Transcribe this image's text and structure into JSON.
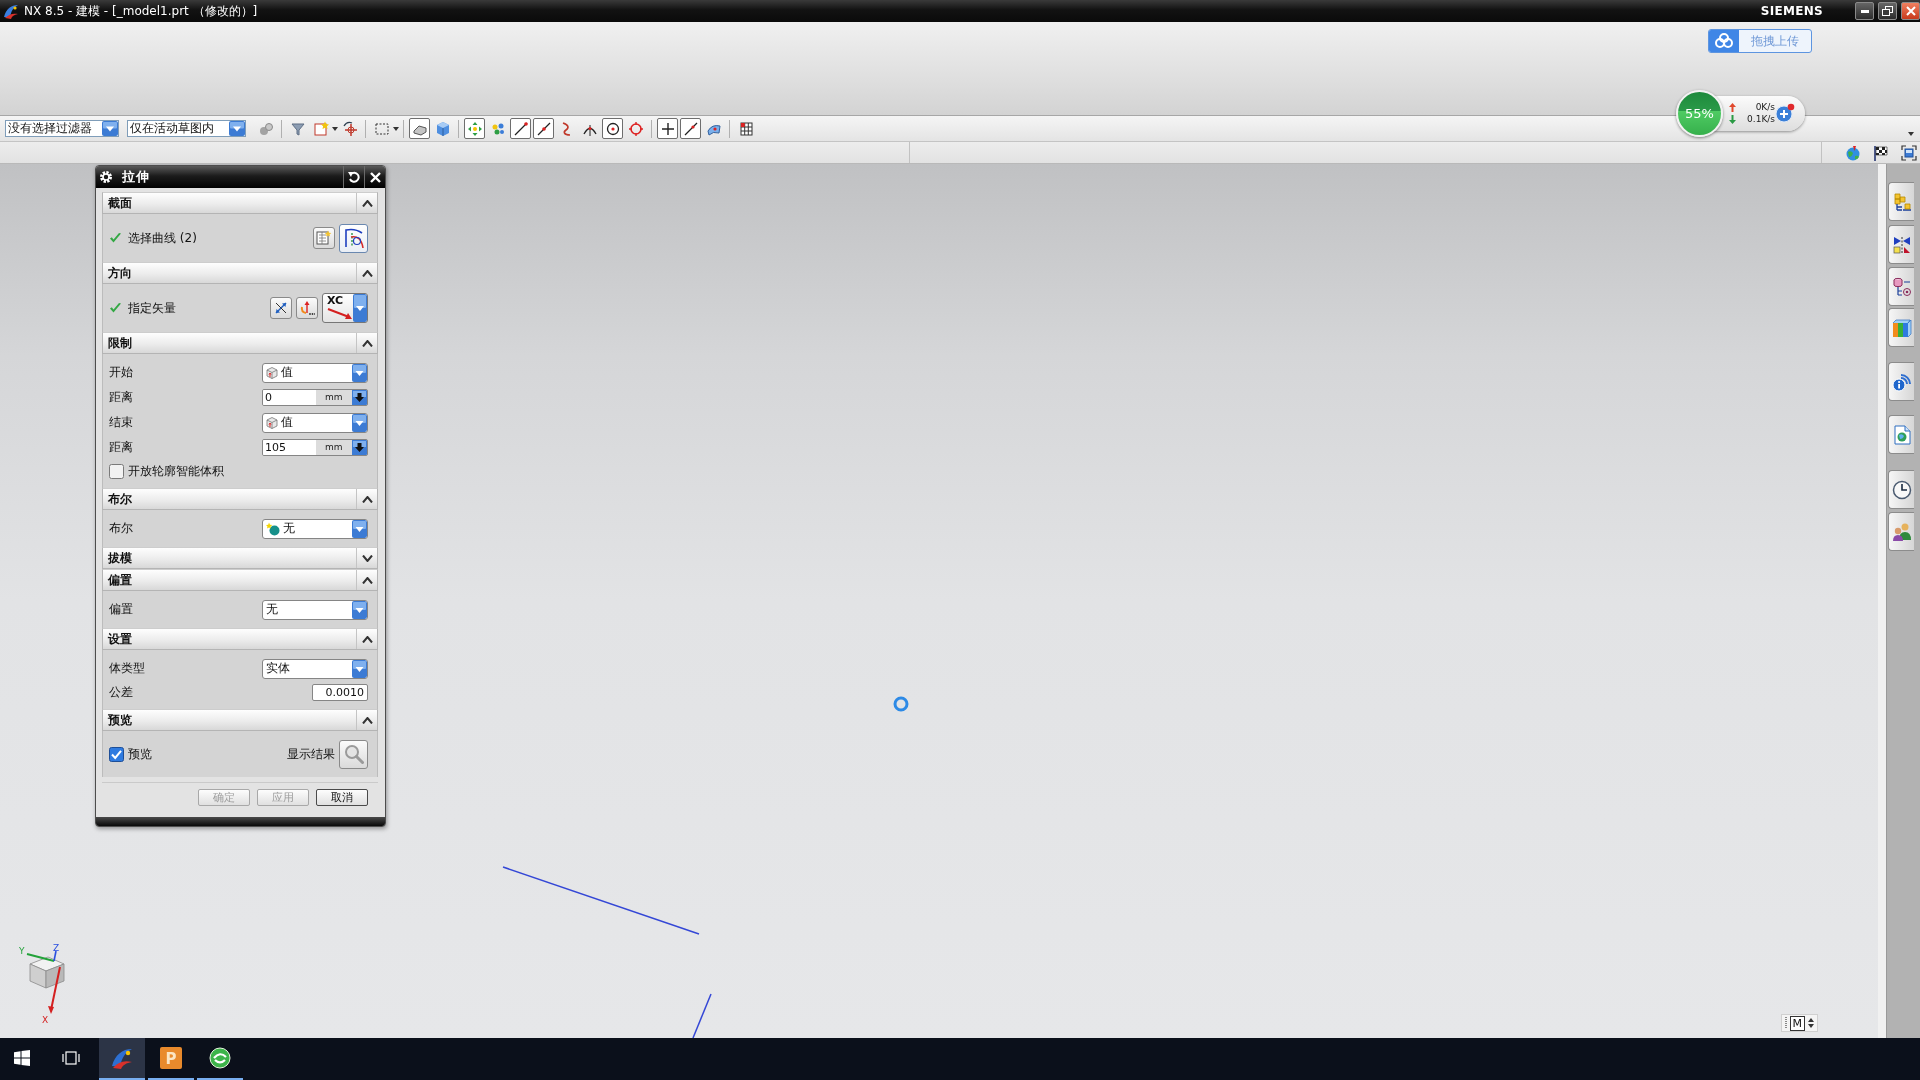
{
  "window": {
    "title": "NX 8.5 - 建模 - [_model1.prt （修改的）]",
    "brand": "SIEMENS"
  },
  "upload_button": {
    "label": "拖拽上传"
  },
  "speed_meter": {
    "percent": "55%",
    "upload": "0K/s",
    "download": "0.1K/s"
  },
  "selection_bar": {
    "filter": "没有选择过滤器",
    "scope": "仅在活动草图内"
  },
  "dialog": {
    "title": "拉伸",
    "sections": [
      {
        "title": "截面",
        "expanded": true,
        "rows": [
          {
            "kind": "selection",
            "label": "选择曲线 (2)",
            "done": true
          }
        ]
      },
      {
        "title": "方向",
        "expanded": true,
        "rows": [
          {
            "kind": "vector",
            "label": "指定矢量",
            "done": true,
            "value": "XC"
          }
        ]
      },
      {
        "title": "限制",
        "expanded": true,
        "rows": [
          {
            "kind": "value_select",
            "label": "开始",
            "value": "值"
          },
          {
            "kind": "number",
            "label": "距离",
            "value": "0",
            "unit": "mm"
          },
          {
            "kind": "value_select",
            "label": "结束",
            "value": "值"
          },
          {
            "kind": "number",
            "label": "距离",
            "value": "105",
            "unit": "mm"
          },
          {
            "kind": "checkbox",
            "label": "开放轮廓智能体积",
            "checked": false
          }
        ]
      },
      {
        "title": "布尔",
        "expanded": true,
        "rows": [
          {
            "kind": "boolean_select",
            "label": "布尔",
            "value": "无"
          }
        ]
      },
      {
        "title": "拔模",
        "expanded": false
      },
      {
        "title": "偏置",
        "expanded": true,
        "rows": [
          {
            "kind": "select",
            "label": "偏置",
            "value": "无"
          }
        ]
      },
      {
        "title": "设置",
        "expanded": true,
        "rows": [
          {
            "kind": "select",
            "label": "体类型",
            "value": "实体"
          },
          {
            "kind": "text_field",
            "label": "公差",
            "value": "0.0010"
          }
        ]
      },
      {
        "title": "预览",
        "expanded": true,
        "rows": [
          {
            "kind": "preview",
            "label": "预览",
            "checked": true,
            "action_label": "显示结果"
          }
        ]
      }
    ],
    "buttons": [
      {
        "label": "确定",
        "disabled": true
      },
      {
        "label": "应用",
        "disabled": true
      },
      {
        "label": "取消",
        "disabled": false
      }
    ]
  },
  "triad": {
    "x_label": "X",
    "y_label": "Y",
    "z_label": "Z"
  },
  "view_mode": {
    "label": "M"
  },
  "taskbar": {
    "apps": [
      {
        "kind": "nx",
        "active": true
      },
      {
        "kind": "presentation",
        "glyph": "P",
        "active": false
      },
      {
        "kind": "browser",
        "active": false
      }
    ]
  }
}
